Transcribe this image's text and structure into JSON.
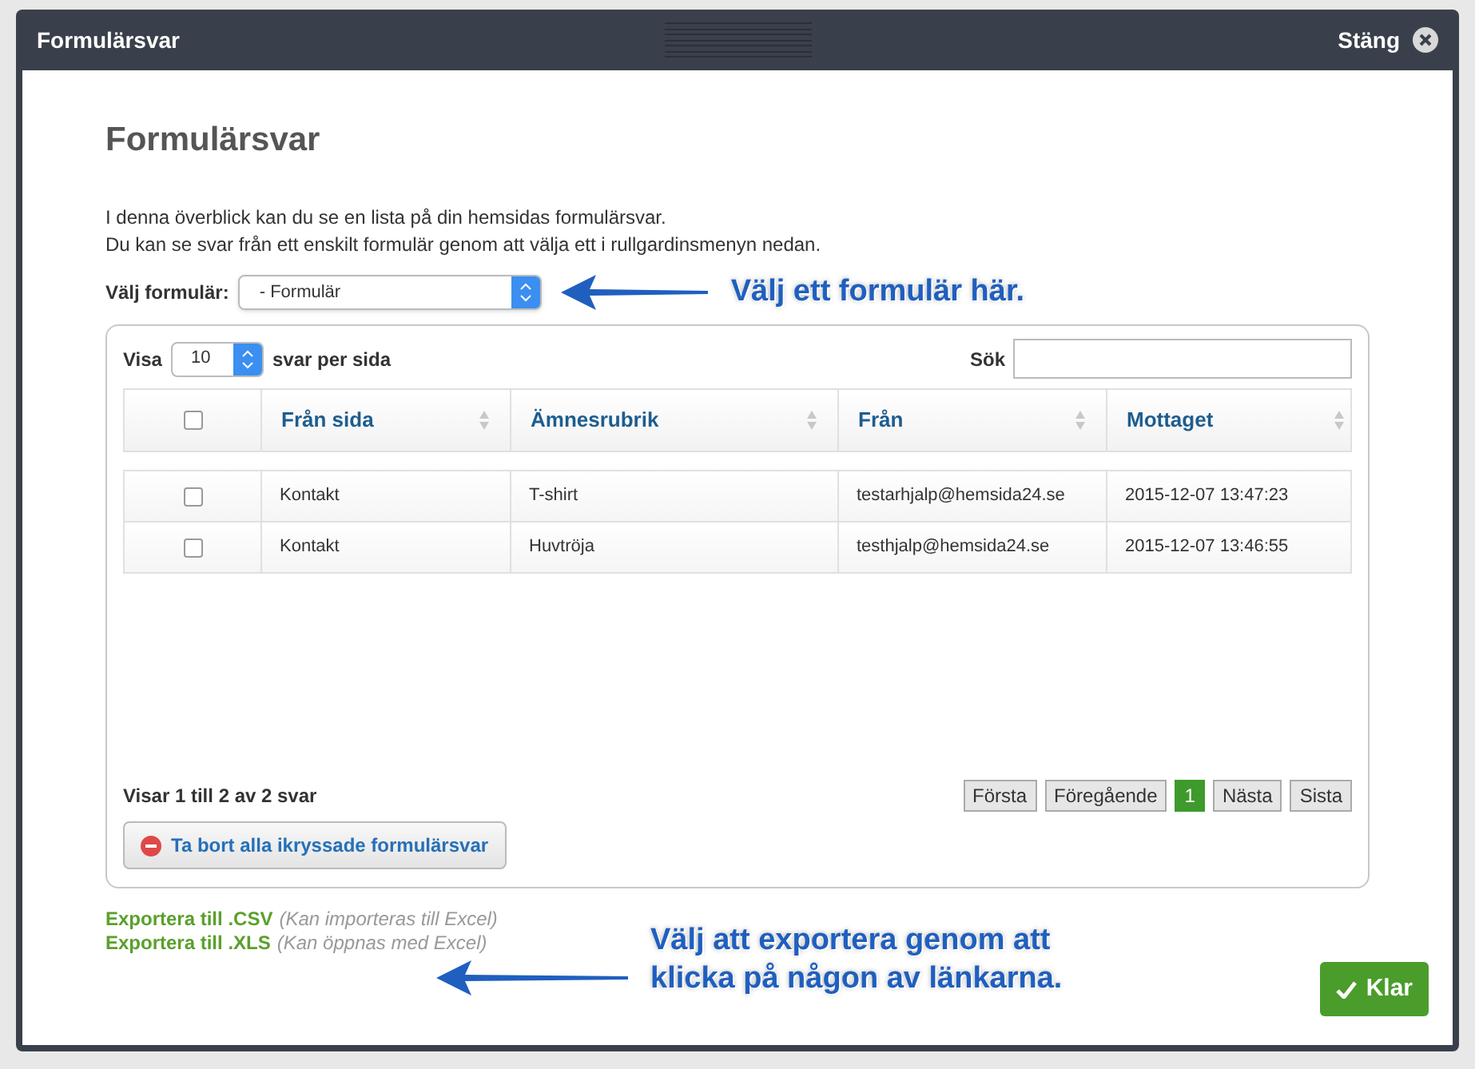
{
  "window": {
    "title": "Formulärsvar",
    "close": "Stäng"
  },
  "heading": "Formulärsvar",
  "intro": [
    "I denna överblick kan du se en lista på din hemsidas formulärsvar.",
    "Du kan se svar från ett enskilt formulär genom att välja ett i rullgardinsmenyn nedan."
  ],
  "form_select": {
    "label": "Välj formulär:",
    "value": "- Formulär"
  },
  "callouts": [
    "Välj ett formulär här.",
    "Välj att exportera genom att klicka på någon av länkarna."
  ],
  "table": {
    "show_label": "Visa",
    "page_size": "10",
    "per_page_label": "svar per sida",
    "search_label": "Sök",
    "columns": [
      "Från sida",
      "Ämnesrubrik",
      "Från",
      "Mottaget"
    ],
    "select_all": false,
    "rows": [
      {
        "checked": false,
        "cells": [
          "Kontakt",
          "T-shirt",
          "testarhjalp@hemsida24.se",
          "2015-12-07 13:47:23"
        ]
      },
      {
        "checked": false,
        "cells": [
          "Kontakt",
          "Huvtröja",
          "testhjalp@hemsida24.se",
          "2015-12-07 13:46:55"
        ]
      }
    ],
    "info": "Visar 1 till 2 av 2 svar",
    "pagination": [
      {
        "label": "Första",
        "selected": false
      },
      {
        "label": "Föregående",
        "selected": false
      },
      {
        "label": "1",
        "selected": true
      },
      {
        "label": "Nästa",
        "selected": false
      },
      {
        "label": "Sista",
        "selected": false
      }
    ],
    "delete_button": "Ta bort alla ikryssade formulärsvar"
  },
  "exports": [
    {
      "link": "Exportera till .CSV",
      "note": "(Kan importeras till Excel)"
    },
    {
      "link": "Exportera till .XLS",
      "note": "(Kan öppnas med Excel)"
    }
  ],
  "done_button": "Klar"
}
